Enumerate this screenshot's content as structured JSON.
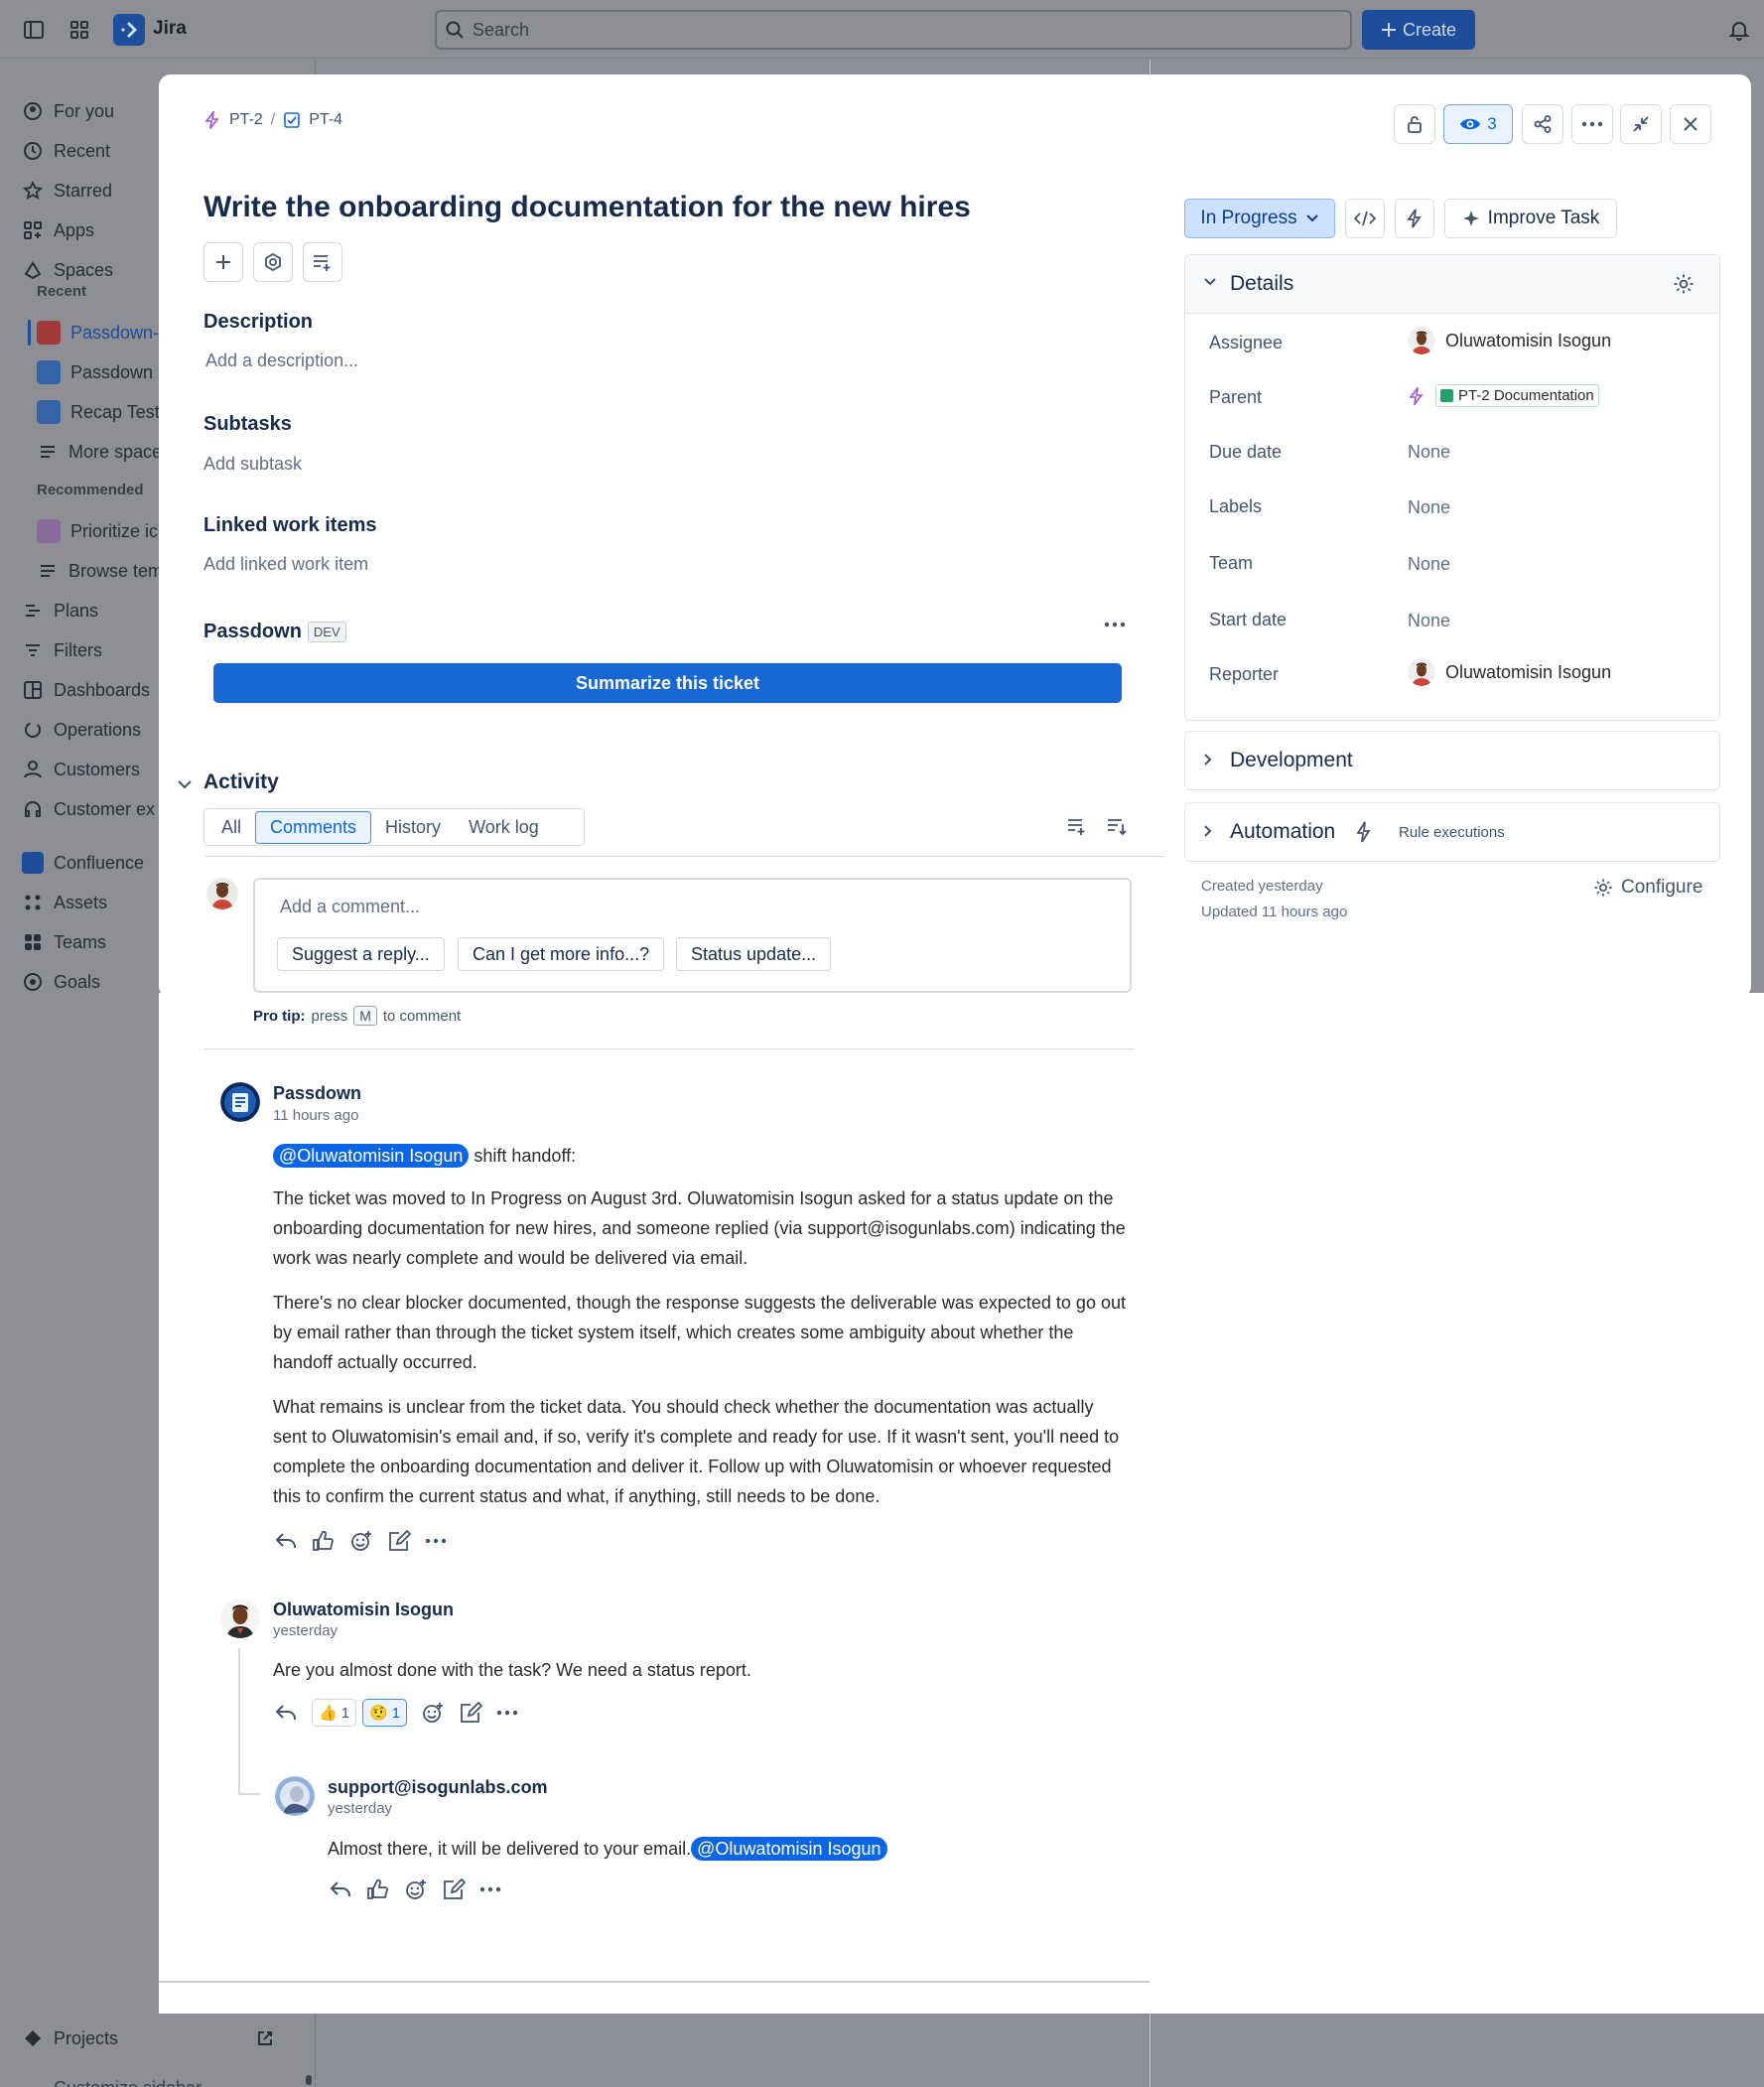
{
  "app": {
    "name": "Jira"
  },
  "topbar": {
    "search_placeholder": "Search",
    "create_label": "Create"
  },
  "sidebar": {
    "items": [
      "For you",
      "Recent",
      "Starred",
      "Apps",
      "Spaces"
    ],
    "recent_label": "Recent",
    "recent_spaces": [
      "Passdown-",
      "Passdown",
      "Recap Test",
      "More spaces"
    ],
    "recommended_label": "Recommended",
    "recommended": [
      "Prioritize ic",
      "Browse tem"
    ],
    "items2": [
      "Plans",
      "Filters",
      "Dashboards",
      "Operations",
      "Customers",
      "Customer ex"
    ],
    "apps": [
      "Confluence",
      "Assets",
      "Teams",
      "Goals"
    ],
    "projects_label": "Projects",
    "customize_label": "Customize sidebar"
  },
  "issue": {
    "breadcrumbs": [
      {
        "key": "PT-2"
      },
      {
        "key": "PT-4"
      }
    ],
    "watchers": "3",
    "title": "Write the onboarding documentation for the new hires",
    "description_label": "Description",
    "description_placeholder": "Add a description...",
    "subtasks_label": "Subtasks",
    "subtasks_placeholder": "Add subtask",
    "linked_label": "Linked work items",
    "linked_placeholder": "Add linked work item",
    "passdown_label": "Passdown",
    "dev_badge": "DEV",
    "summarize_label": "Summarize this ticket"
  },
  "activity": {
    "label": "Activity",
    "tabs": [
      "All",
      "Comments",
      "History",
      "Work log"
    ],
    "comment_placeholder": "Add a comment...",
    "quick_replies": [
      "Suggest a reply...",
      "Can I get more info...?",
      "Status update..."
    ],
    "protip_bold": "Pro tip:",
    "protip_pre": "press",
    "protip_key": "M",
    "protip_post": "to comment"
  },
  "comments": [
    {
      "author": "Passdown",
      "time": "11 hours ago",
      "mention": "@Oluwatomisin Isogun",
      "mention_suffix": "shift handoff:",
      "paragraphs": [
        "The ticket was moved to In Progress on August 3rd. Oluwatomisin Isogun asked for a status update on the onboarding documentation for new hires, and someone replied (via support@isogunlabs.com) indicating the work was nearly complete and would be delivered via email.",
        "There's no clear blocker documented, though the response suggests the deliverable was expected to go out by email rather than through the ticket system itself, which creates some ambiguity about whether the handoff actually occurred.",
        "What remains is unclear from the ticket data. You should check whether the documentation was actually sent to Oluwatomisin's email and, if so, verify it's complete and ready for use. If it wasn't sent, you'll need to complete the onboarding documentation and deliver it. Follow up with Oluwatomisin or whoever requested this to confirm the current status and what, if anything, still needs to be done."
      ]
    },
    {
      "author": "Oluwatomisin Isogun",
      "time": "yesterday",
      "text": "Are you almost done with the task? We need a status report.",
      "reactions": [
        {
          "emoji": "👍",
          "count": "1"
        },
        {
          "emoji": "🤨",
          "count": "1"
        }
      ]
    },
    {
      "author": "support@isogunlabs.com",
      "time": "yesterday",
      "text": "Almost there, it will be delivered to your email.",
      "mention": "@Oluwatomisin Isogun"
    }
  ],
  "panel": {
    "status": "In Progress",
    "improve_label": "Improve Task",
    "details_label": "Details",
    "fields": [
      {
        "label": "Assignee",
        "value": "Oluwatomisin Isogun"
      },
      {
        "label": "Parent",
        "value": "PT-2 Documentation"
      },
      {
        "label": "Due date",
        "value": "None"
      },
      {
        "label": "Labels",
        "value": "None"
      },
      {
        "label": "Team",
        "value": "None"
      },
      {
        "label": "Start date",
        "value": "None"
      },
      {
        "label": "Reporter",
        "value": "Oluwatomisin Isogun"
      }
    ],
    "development_label": "Development",
    "automation_label": "Automation",
    "rule_executions": "Rule executions",
    "created": "Created yesterday",
    "updated": "Updated 11 hours ago",
    "configure_label": "Configure"
  },
  "colors": {
    "accent": "#0c66e4",
    "status_bg": "#cce0ff",
    "summarize_bg": "#1967d2",
    "overlay": "#8e8f94"
  }
}
